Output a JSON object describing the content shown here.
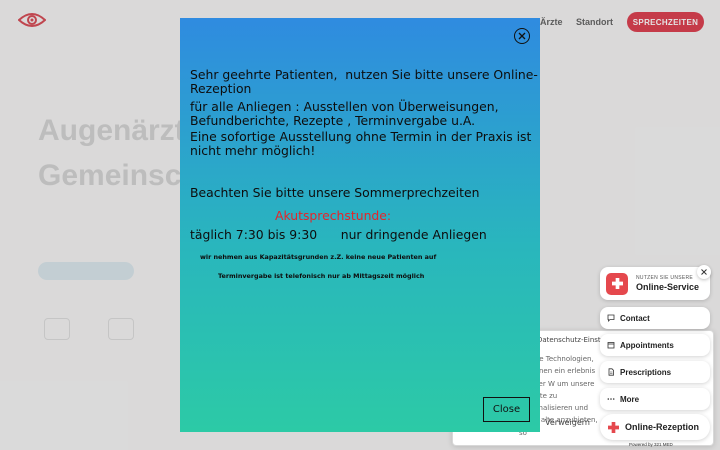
{
  "nav": {
    "aerzte": "Ärzte",
    "standort": "Standort",
    "cta": "SPRECHZEITEN"
  },
  "hero": {
    "title_line1": "Augenärzt",
    "title_line2": "Gemeinsch"
  },
  "cookie": {
    "title": "Datenschutz-Einst",
    "text": "andere Technologien, um Ihnen ein erlebnis unserer W um unsere Website zu personalisieren und Ihnen alte anzubieten, so",
    "deny": "Verweigern"
  },
  "modal": {
    "line1": "Sehr geehrte Patienten,  nutzen Sie bitte unsere Online-\nRezeption",
    "line2": "für alle Anliegen : Ausstellen von Überweisungen,\nBefundberichte, Rezepte , Terminvergabe u.A.",
    "line3": "Eine sofortige Ausstellung ohne Termin in der Praxis ist\nnicht mehr möglich!",
    "line4": "Beachten Sie bitte unsere Sommerprechzeiten",
    "acute_label": "Akutsprechstunde:",
    "acute_hours": "täglich 7:30 bis 9:30      nur dringende Anliegen",
    "note1": "wir nehmen aus Kapazitätsgrunden z.Z. keine neue Patienten auf",
    "note2": "Terminvergabe ist  telefonisch nur ab Mittagszeit möglich",
    "close_label": "Close",
    "accent_color": "#e3262b"
  },
  "widget": {
    "service_small": "NUTZEN SIE UNSERE",
    "service_big": "Online-Service",
    "contact": "Contact",
    "appointments": "Appointments",
    "prescriptions": "Prescriptions",
    "more": "More",
    "online": "Online-Rezeption",
    "powered": "Powered by 321 MED",
    "brand_color": "#e5484d"
  }
}
